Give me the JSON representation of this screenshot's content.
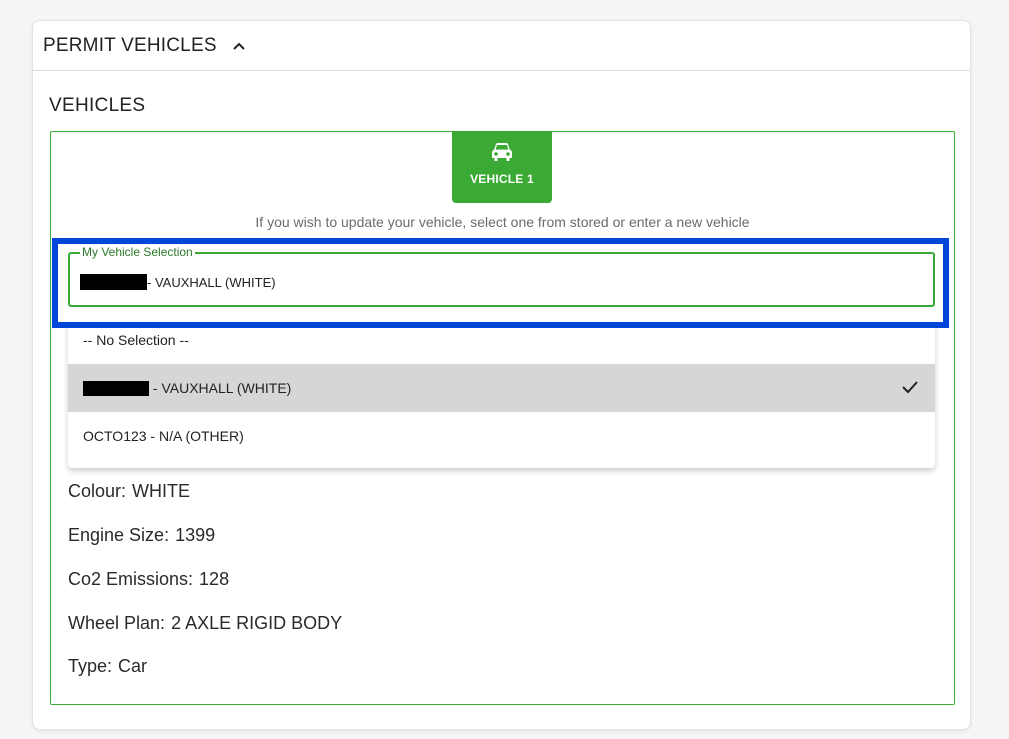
{
  "card": {
    "title": "PERMIT VEHICLES",
    "section_title": "VEHICLES"
  },
  "vehicle_tab": {
    "label": "VEHICLE 1",
    "icon": "car-icon"
  },
  "hint": "If you wish to update your vehicle, select one from stored or enter a new vehicle",
  "select": {
    "legend": "My Vehicle Selection",
    "value_suffix": "- VAUXHALL (WHITE)"
  },
  "dropdown": {
    "options": [
      {
        "label": "-- No Selection --"
      },
      {
        "label": " - VAUXHALL (WHITE)",
        "selected": true
      },
      {
        "label": "OCTO123 - N/A (OTHER)"
      }
    ]
  },
  "details": [
    {
      "key": "Colour:",
      "value": "WHITE"
    },
    {
      "key": "Engine Size:",
      "value": "1399"
    },
    {
      "key": "Co2 Emissions:",
      "value": "128"
    },
    {
      "key": "Wheel Plan:",
      "value": "2 AXLE RIGID BODY"
    },
    {
      "key": "Type:",
      "value": "Car"
    }
  ],
  "colors": {
    "accent_green": "#3aaa35",
    "highlight_blue": "#0047d9",
    "selected_bg": "#d6d6d6"
  }
}
